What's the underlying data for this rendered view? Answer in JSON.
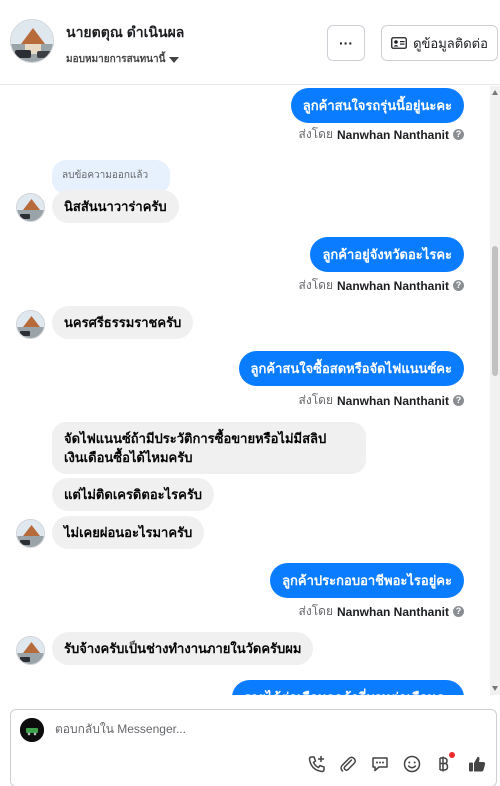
{
  "header": {
    "contact_name": "นายตตุณ ดำเนินผล",
    "assign_label": "มอบหมายการสนทนานี้",
    "more_label": "···",
    "contact_info_label": "ดูข้อมูลติดต่อ"
  },
  "thread": {
    "deleted_notice": "ลบข้อความออกแล้ว",
    "sent_by_prefix": "ส่งโดย",
    "agent_name": "Nanwhan Nanthanit",
    "info_glyph": "?",
    "messages": [
      {
        "side": "out",
        "text": "ลูกค้าสนใจรถรุ่นนี้อยู่นะคะ"
      },
      {
        "side": "in",
        "text": "นิสสันนาวาร่าครับ"
      },
      {
        "side": "out",
        "text": "ลูกค้าอยู่จังหวัดอะไรคะ"
      },
      {
        "side": "in",
        "text": "นครศรีธรรมราชครับ"
      },
      {
        "side": "out",
        "text": "ลูกค้าสนใจซื้อสดหรือจัดไฟแนนซ์คะ"
      },
      {
        "side": "in",
        "text": "จัดไฟแนนซ์ถ้ามีประวัติการซื้อขายหรือไม่มีสลิป"
      },
      {
        "side": "in",
        "text": "เงินเดือนซื้อได้ไหมครับ"
      },
      {
        "side": "in",
        "text": "แต่ไม่ติดเครดิตอะไรครับ"
      },
      {
        "side": "in",
        "text": "ไม่เคยผ่อนอะไรมาครับ"
      },
      {
        "side": "out",
        "text": "ลูกค้าประกอบอาชีพอะไรอยู่คะ"
      },
      {
        "side": "in",
        "text": "รับจ้างครับเป็นช่างทำงานภายในวัดครับผม"
      },
      {
        "side": "out",
        "text": "รายได้ต่อเดือนลูกค้ากี่บาทต่อเดือนคะ"
      }
    ]
  },
  "composer": {
    "placeholder": "ตอบกลับใน Messenger...",
    "tools": [
      "add-call-icon",
      "attach-icon",
      "saved-reply-icon",
      "emoji-icon",
      "payment-icon",
      "like-icon"
    ]
  },
  "colors": {
    "outgoing_bubble": "#0a7cff",
    "incoming_bubble": "#f0f0f0",
    "deleted_bubble": "#e7f0fd",
    "notification_dot": "#ee2b2b"
  }
}
